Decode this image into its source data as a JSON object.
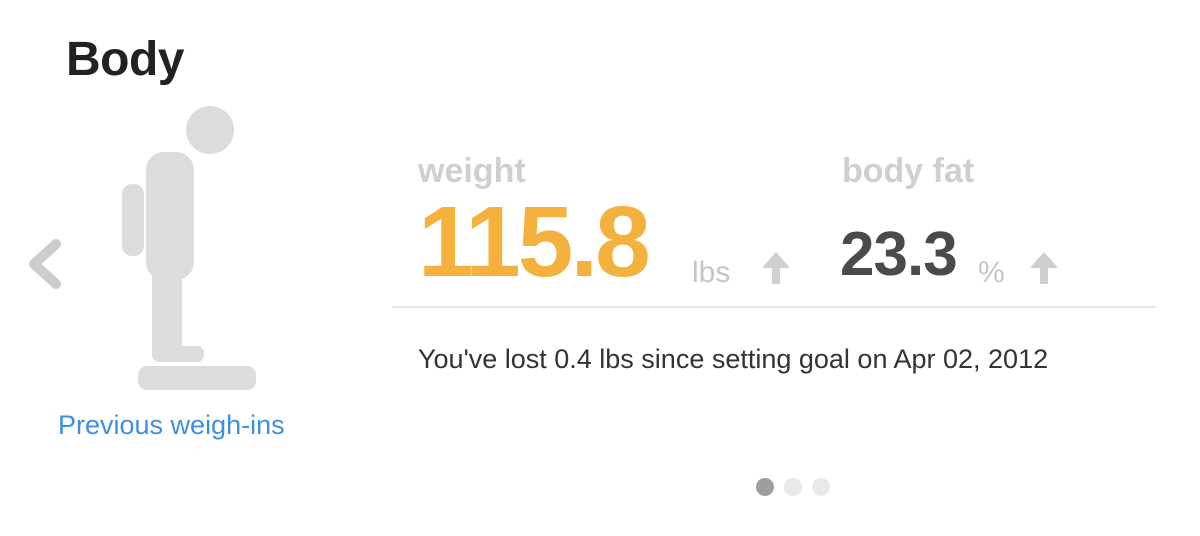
{
  "header": {
    "title": "Body"
  },
  "navigation": {
    "prev_icon": "chevron-left-icon",
    "prev_link_label": "Previous weigh-ins"
  },
  "figure": {
    "icon": "person-on-scale-icon"
  },
  "metrics": {
    "weight": {
      "label": "weight",
      "value": "115.8",
      "unit": "lbs",
      "trend_icon": "arrow-up-icon"
    },
    "body_fat": {
      "label": "body fat",
      "value": "23.3",
      "unit": "%",
      "trend_icon": "arrow-up-icon"
    }
  },
  "summary": {
    "text": "You've lost 0.4 lbs since setting goal on Apr 02, 2012"
  },
  "pager": {
    "pages": 3,
    "active_index": 0
  },
  "colors": {
    "title": "#222222",
    "weight_value": "#f5b13d",
    "fat_value": "#4a4a4a",
    "label": "#cfcfcf",
    "link": "#3d8fe0",
    "figure": "#dcdcdc"
  }
}
